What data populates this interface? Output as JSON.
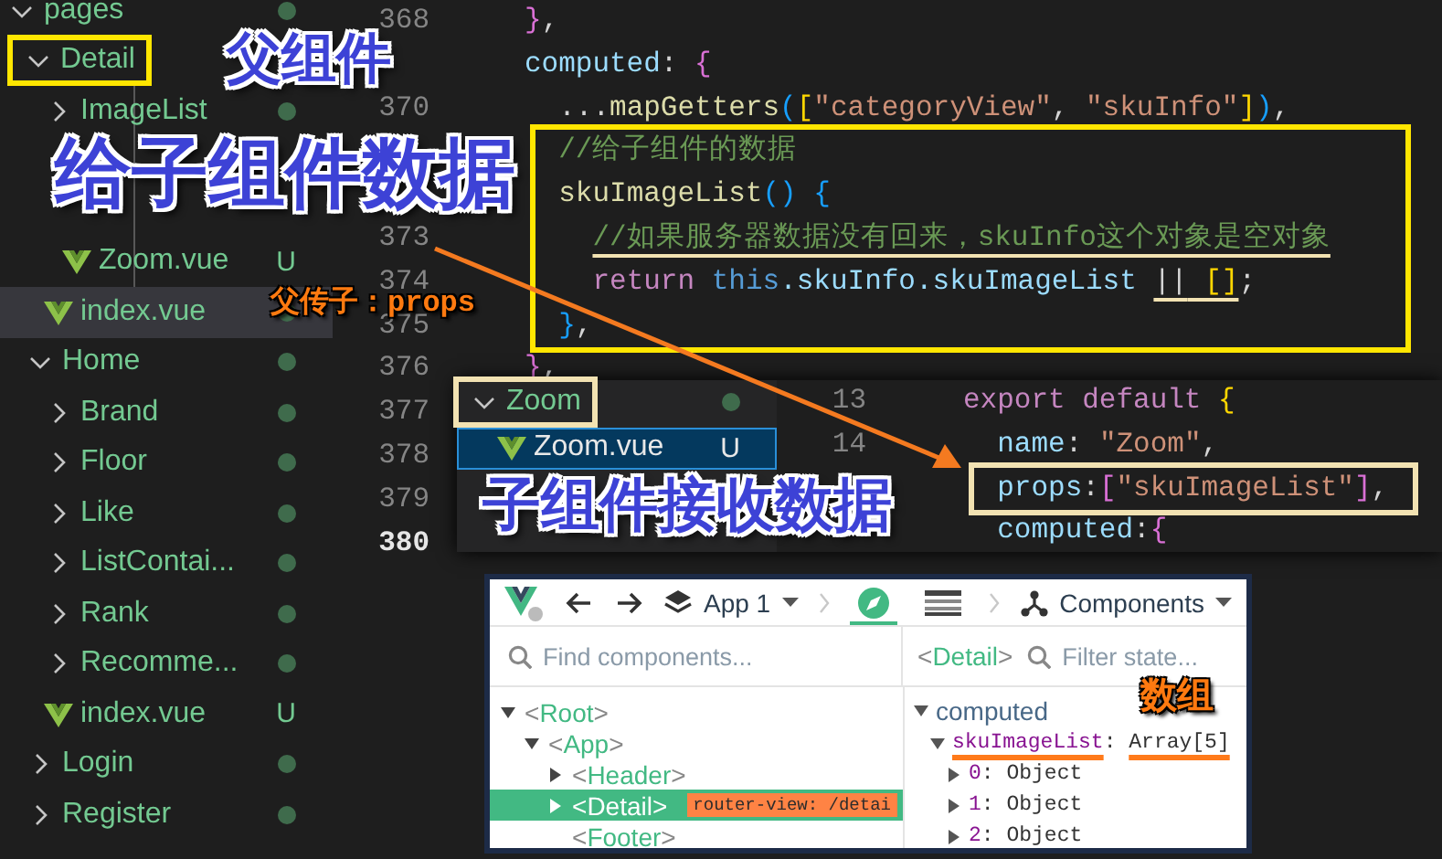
{
  "explorer": {
    "tree": [
      {
        "label": "pages",
        "kind": "folder",
        "expanded": true,
        "selected": false,
        "dot": true,
        "children": [
          {
            "label": "Detail",
            "kind": "folder",
            "expanded": true,
            "selected": false,
            "framed": true,
            "children": [
              {
                "label": "ImageList",
                "kind": "folder",
                "expanded": false,
                "selected": false,
                "dot": true
              },
              {
                "children": [
                  {
                    "label": "Zoom.vue",
                    "kind": "vue",
                    "selected": false,
                    "badge": "U"
                  }
                ]
              },
              {
                "label": "index.vue",
                "kind": "vue",
                "selected": true,
                "dot": true
              }
            ]
          },
          {
            "label": "Home",
            "kind": "folder",
            "expanded": true,
            "selected": false,
            "dot": true,
            "children": [
              {
                "label": "Brand",
                "kind": "folder",
                "expanded": false,
                "selected": false,
                "dot": true
              },
              {
                "label": "Floor",
                "kind": "folder",
                "expanded": false,
                "selected": false,
                "dot": true
              },
              {
                "label": "Like",
                "kind": "folder",
                "expanded": false,
                "selected": false,
                "dot": true
              },
              {
                "label": "ListContai...",
                "kind": "folder",
                "expanded": false,
                "selected": false,
                "dot": true
              },
              {
                "label": "Rank",
                "kind": "folder",
                "expanded": false,
                "selected": false,
                "dot": true
              },
              {
                "label": "Recomme...",
                "kind": "folder",
                "expanded": false,
                "selected": false,
                "dot": true
              },
              {
                "label": "index.vue",
                "kind": "vue",
                "selected": false,
                "badge": "U"
              }
            ]
          },
          {
            "label": "Login",
            "kind": "folder",
            "expanded": false,
            "selected": false,
            "dot": true
          },
          {
            "label": "Register",
            "kind": "folder",
            "expanded": false,
            "selected": false,
            "dot": true
          }
        ]
      }
    ]
  },
  "editor": {
    "lines": [
      {
        "number": "368",
        "current": false,
        "tokens": [
          {
            "text": "}",
            "kind": "brace2"
          },
          {
            "text": ",",
            "kind": "plain"
          }
        ]
      },
      {
        "tokens": [
          {
            "text": "computed",
            "kind": "prop"
          },
          {
            "text": ": ",
            "kind": "plain"
          },
          {
            "text": "{",
            "kind": "brace2"
          }
        ]
      },
      {
        "number": "370",
        "current": false,
        "tokens": [
          {
            "text": "  ...",
            "kind": "plain"
          },
          {
            "text": "mapGetters",
            "kind": "func"
          },
          {
            "text": "(",
            "kind": "brace3"
          },
          {
            "text": "[",
            "kind": "brace1"
          },
          {
            "text": "\"categoryView\"",
            "kind": "string"
          },
          {
            "text": ", ",
            "kind": "plain"
          },
          {
            "text": "\"skuInfo\"",
            "kind": "string"
          },
          {
            "text": "]",
            "kind": "brace1"
          },
          {
            "text": ")",
            "kind": "brace3"
          },
          {
            "text": ",",
            "kind": "plain"
          }
        ]
      },
      {
        "framed": true,
        "tokens": [
          {
            "text": "  //给子组件的数据",
            "kind": "comment"
          }
        ]
      },
      {
        "framed": true,
        "tokens": [
          {
            "text": "  skuImageList",
            "kind": "func"
          },
          {
            "text": "() {",
            "kind": "brace3"
          }
        ]
      },
      {
        "number": "373",
        "current": false,
        "framed": true,
        "tokens": [
          {
            "text": "    //如果服务器数据没有回来，skuInfo这个对象是空对象",
            "kind": "comment",
            "underlined": true
          }
        ]
      },
      {
        "number": "374",
        "current": false,
        "framed": true,
        "tokens": [
          {
            "text": "    return ",
            "kind": "keyword"
          },
          {
            "text": "this",
            "kind": "this"
          },
          {
            "text": ".skuInfo.skuImageList ",
            "kind": "prop"
          },
          {
            "text": "||",
            "kind": "plain",
            "underlined": true
          },
          {
            "text": " []",
            "kind": "brace1",
            "underlined": true
          },
          {
            "text": ";",
            "kind": "plain"
          }
        ]
      },
      {
        "number": "375",
        "current": false,
        "framed": true,
        "tokens": [
          {
            "text": "  }",
            "kind": "brace3"
          },
          {
            "text": ",",
            "kind": "plain"
          }
        ]
      },
      {
        "number": "376",
        "current": false,
        "tokens": [
          {
            "text": "}",
            "kind": "brace2"
          },
          {
            "text": ",",
            "kind": "plain"
          }
        ]
      },
      {
        "number": "377",
        "current": false
      },
      {
        "number": "378",
        "current": false
      },
      {
        "number": "379",
        "current": false
      },
      {
        "number": "380",
        "current": true
      }
    ]
  },
  "popup": {
    "tree": [
      {
        "label": "Zoom",
        "kind": "folder",
        "expanded": true,
        "selected": false,
        "framed": true,
        "dot": true,
        "children": [
          {
            "label": "Zoom.vue",
            "kind": "vue",
            "selected": true,
            "badge": "U"
          }
        ]
      }
    ],
    "lines": [
      {
        "number": "13",
        "current": false,
        "tokens": [
          {
            "text": "export default ",
            "kind": "keyword"
          },
          {
            "text": "{",
            "kind": "brace1"
          }
        ]
      },
      {
        "number": "14",
        "current": false,
        "tokens": [
          {
            "text": "  name",
            "kind": "prop"
          },
          {
            "text": ": ",
            "kind": "plain"
          },
          {
            "text": "\"Zoom\"",
            "kind": "string"
          },
          {
            "text": ",",
            "kind": "plain"
          }
        ]
      },
      {
        "framed": true,
        "tokens": [
          {
            "text": "  props",
            "kind": "prop"
          },
          {
            "text": ":",
            "kind": "plain"
          },
          {
            "text": "[",
            "kind": "brace2"
          },
          {
            "text": "\"skuImageList\"",
            "kind": "string"
          },
          {
            "text": "]",
            "kind": "brace2"
          },
          {
            "text": ",",
            "kind": "plain"
          }
        ]
      },
      {
        "tokens": [
          {
            "text": "  computed",
            "kind": "prop"
          },
          {
            "text": ":",
            "kind": "plain"
          },
          {
            "text": "{",
            "kind": "brace2"
          }
        ]
      }
    ]
  },
  "devtools": {
    "app": "App 1",
    "view": "Components",
    "tools": [
      {
        "kind": "compass",
        "selected": true
      },
      {
        "kind": "table",
        "selected": false
      }
    ],
    "component_search": {
      "placeholder": "Find components..."
    },
    "selected_component": "<Detail>",
    "state_filter": {
      "placeholder": "Filter state..."
    },
    "component_tree": [
      {
        "label": "<Root>",
        "kind": "node",
        "expanded": true,
        "selected": false,
        "children": [
          {
            "label": "<App>",
            "kind": "node",
            "expanded": true,
            "selected": false,
            "children": [
              {
                "label": "<Header>",
                "kind": "node",
                "expanded": false,
                "selected": false
              },
              {
                "label": "<Detail>",
                "kind": "node",
                "expanded": false,
                "selected": true,
                "tag": "router-view: /detai"
              },
              {
                "label": "<Footer>",
                "kind": "leaf",
                "selected": false
              }
            ]
          }
        ]
      }
    ],
    "state": [
      {
        "section": "computed",
        "expanded": true,
        "children": [
          {
            "key": "skuImageList",
            "value": "Array[5]",
            "expanded": true,
            "annotated": true,
            "children": [
              {
                "key": "0",
                "value": "Object",
                "expanded": false,
                "annotated": false
              },
              {
                "key": "1",
                "value": "Object",
                "expanded": false,
                "annotated": false
              },
              {
                "key": "2",
                "value": "Object",
                "expanded": false,
                "annotated": false
              }
            ]
          }
        ]
      }
    ]
  },
  "annotations": [
    {
      "kind": "caption",
      "text": "父组件"
    },
    {
      "kind": "caption",
      "text": "给子组件数据"
    },
    {
      "kind": "note",
      "text": "父传子：props"
    },
    {
      "kind": "caption",
      "text": "子组件接收数据"
    },
    {
      "kind": "note",
      "text": "数组"
    }
  ]
}
